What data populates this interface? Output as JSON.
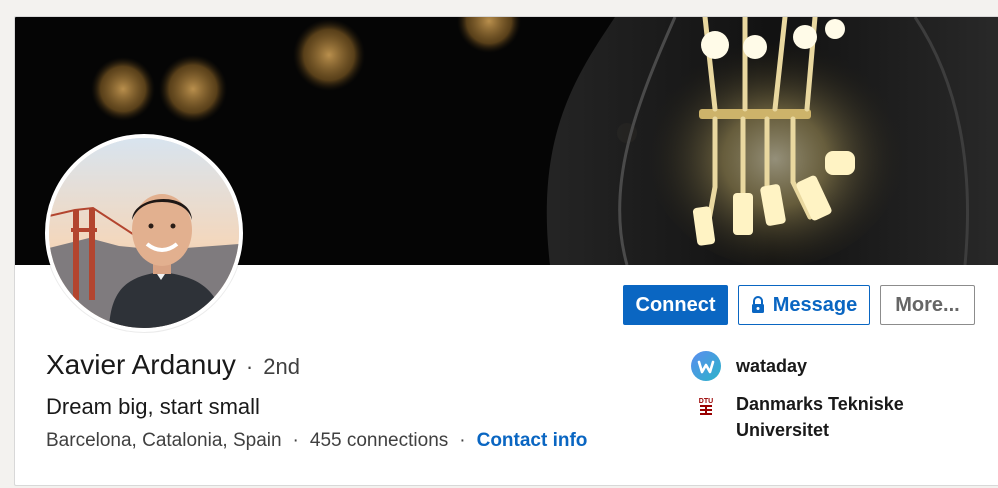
{
  "profile": {
    "name": "Xavier Ardanuy",
    "separator": "·",
    "degree": "2nd",
    "headline": "Dream big, start small",
    "location": "Barcelona, Catalonia, Spain",
    "connections": "455 connections",
    "contact_info": "Contact info"
  },
  "actions": {
    "connect_label": "Connect",
    "message_label": "Message",
    "more_label": "More..."
  },
  "organizations": [
    {
      "name": "wataday",
      "logo_text": "w",
      "logo_color": "#3a7bd5"
    },
    {
      "name": "Danmarks Tekniske Universitet",
      "logo_text": "DTU",
      "logo_color": "#990000"
    }
  ],
  "meta_separator": "·",
  "colors": {
    "accent": "#0a66c2",
    "banner_bg": "#050505",
    "text_primary": "#191919",
    "text_secondary": "#404040"
  }
}
